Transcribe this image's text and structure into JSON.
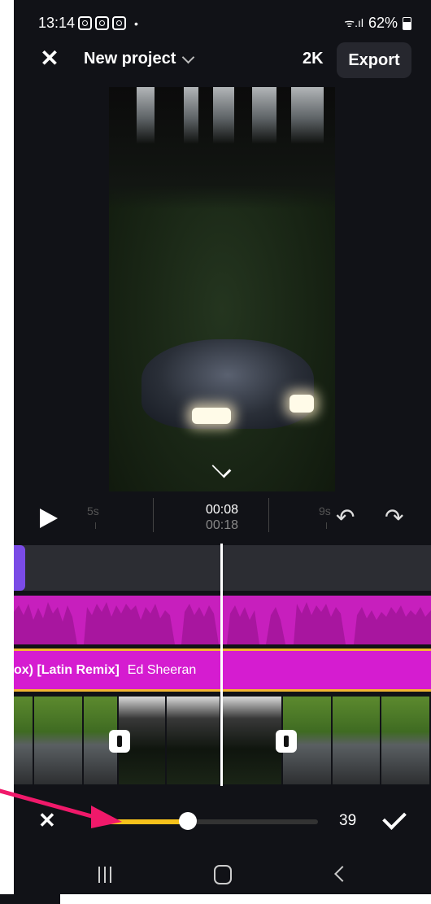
{
  "status_bar": {
    "time": "13:14",
    "battery": "62%"
  },
  "header": {
    "close_icon": "close-icon",
    "project_title": "New project",
    "resolution": "2K",
    "export_label": "Export"
  },
  "player": {
    "tick_5s": "5s",
    "tick_9s": "9s",
    "current_time": "00:08",
    "total_time": "00:18"
  },
  "timeline": {
    "audio_track": {
      "song_title": "ox) [Latin Remix]",
      "artist": "Ed Sheeran"
    }
  },
  "adjust": {
    "value": "39",
    "slider_fraction": 0.39,
    "accent_color": "#f7c21b"
  },
  "colors": {
    "audio_track": "#d51cd0",
    "audio_border": "#f2b632",
    "overlay_clip": "#7a4be6",
    "annotation_arrow": "#f0196a"
  }
}
